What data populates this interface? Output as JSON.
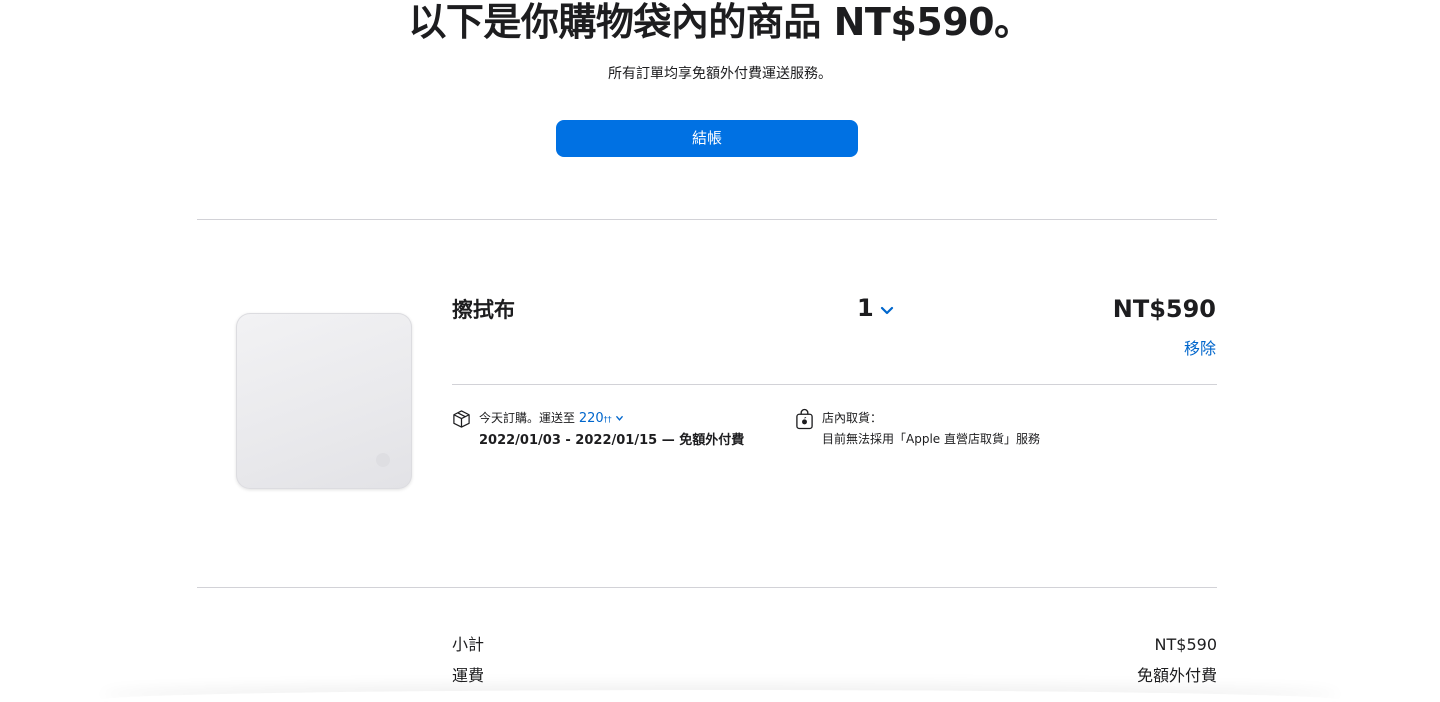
{
  "header": {
    "headline": "以下是你購物袋內的商品 NT$590。",
    "subtext": "所有訂單均享免額外付費運送服務。",
    "checkout_label": "結帳"
  },
  "item": {
    "name": "擦拭布",
    "quantity": "1",
    "price": "NT$590",
    "remove_label": "移除",
    "image_icon": "polishing-cloth-image",
    "delivery": {
      "icon": "box-icon",
      "line1_prefix": "今天訂購。運送至",
      "zip": "220",
      "zip_suffix": "††",
      "line2": "2022/01/03 - 2022/01/15 — 免額外付費"
    },
    "pickup": {
      "icon": "store-bag-icon",
      "line1": "店內取貨：",
      "line2": "目前無法採用「Apple 直營店取貨」服務"
    }
  },
  "summary": {
    "subtotal_label": "小計",
    "subtotal_value": "NT$590",
    "shipping_label": "運費",
    "shipping_value": "免額外付費"
  },
  "colors": {
    "accent": "#0071e3",
    "link": "#0066cc",
    "text": "#1d1d1f",
    "divider": "#d2d2d7"
  }
}
